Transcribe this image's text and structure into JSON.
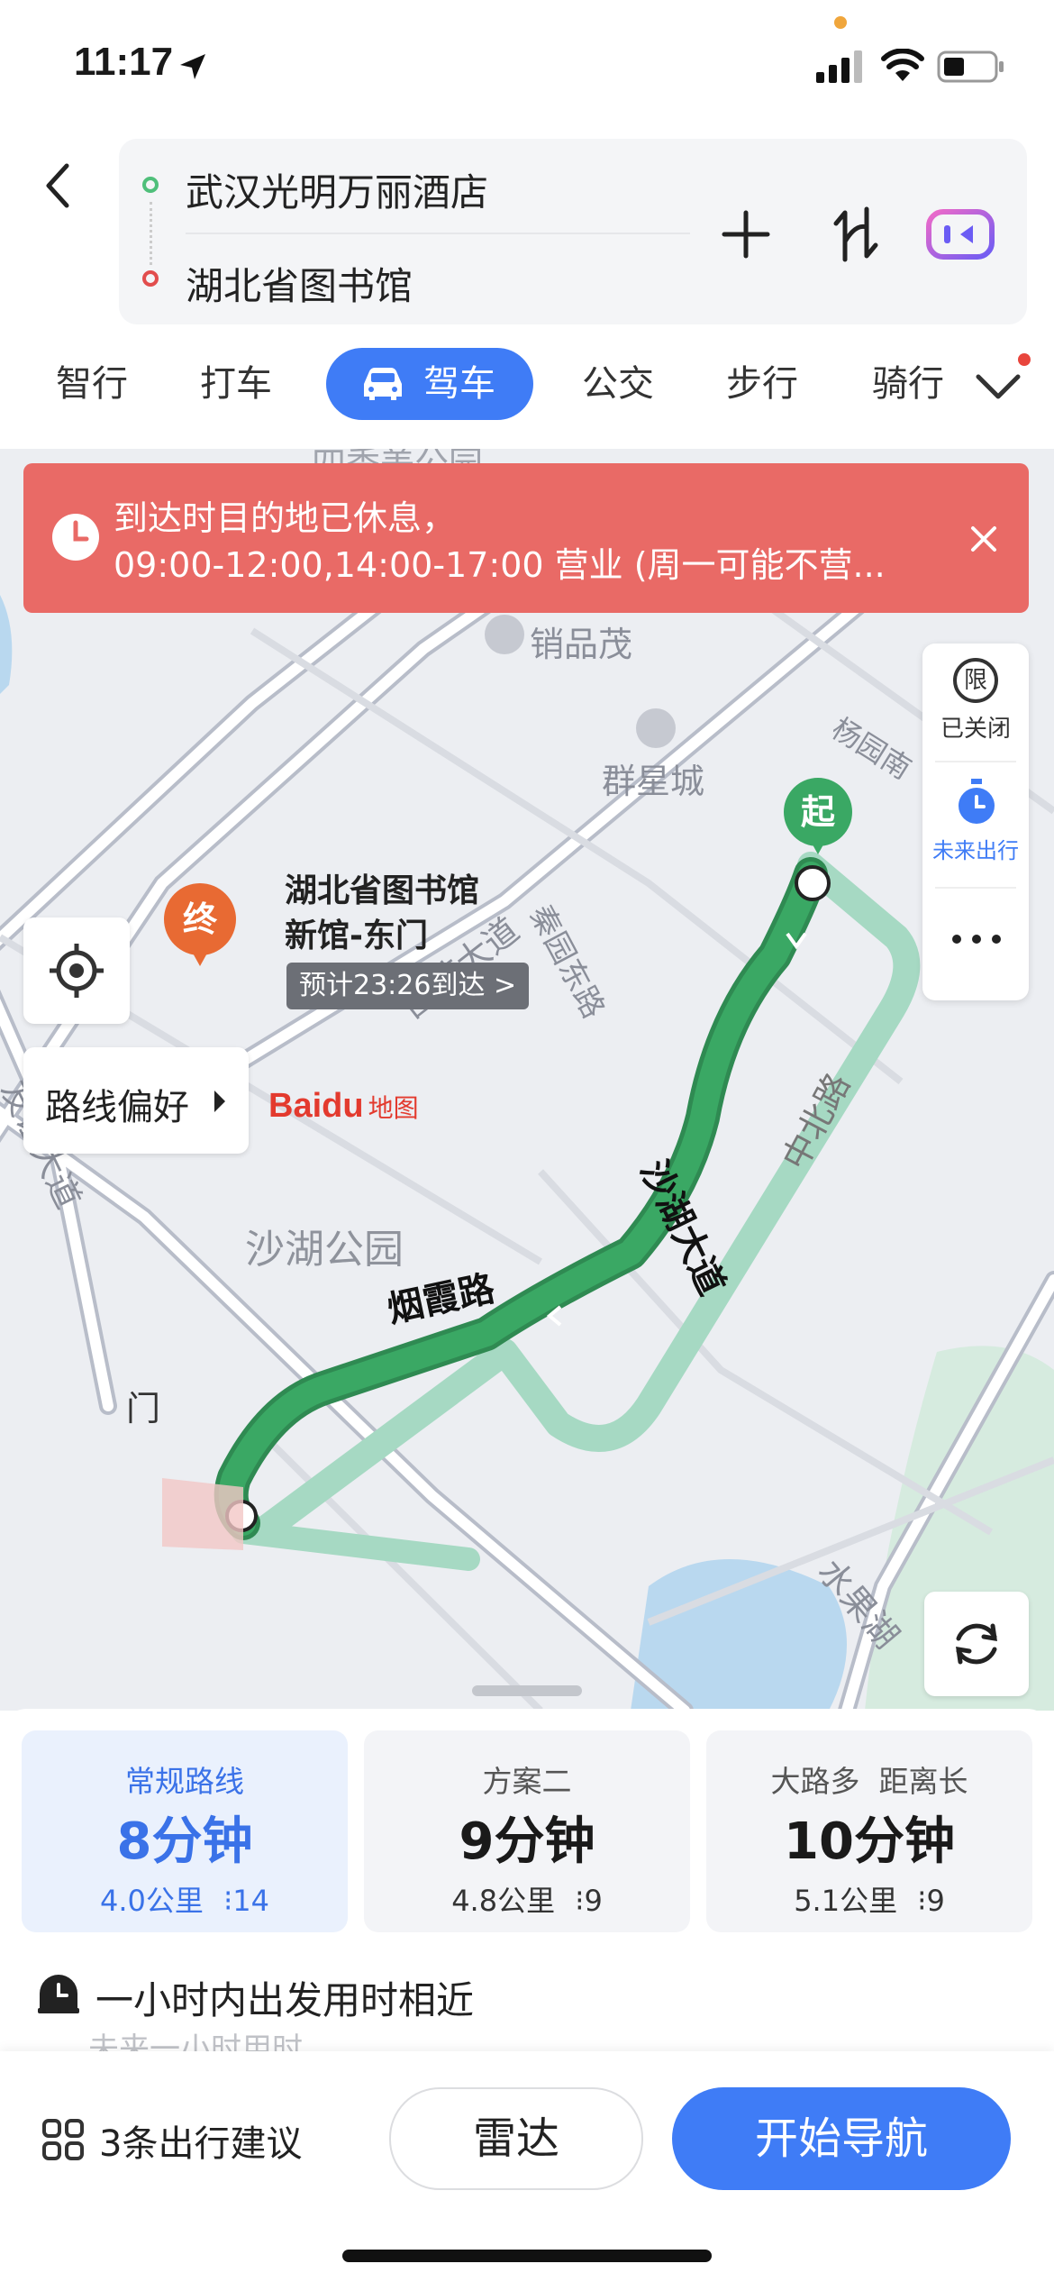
{
  "status_bar": {
    "time": "11:17"
  },
  "route": {
    "origin": "武汉光明万丽酒店",
    "destination": "湖北省图书馆"
  },
  "mode_tabs": [
    "智行",
    "打车",
    "驾车",
    "公交",
    "步行",
    "骑行"
  ],
  "alert": {
    "line1": "到达时目的地已休息，",
    "line2": "09:00-12:00,14:00-17:00 营业 (周一可能不营..."
  },
  "right_panel": {
    "restrict_label": "已关闭",
    "restrict_icon_char": "限",
    "future_label": "未来出行"
  },
  "map": {
    "labels": {
      "park_top": "四季美公园",
      "xiaopinmao": "销品茂",
      "qunxingcheng": "群星城",
      "yangyuan": "杨园南",
      "tuanjie": "团结大道",
      "qinyuan": "秦园东路",
      "youyi": "友谊大道",
      "shahu_park": "沙湖公园",
      "shahu_ave": "沙湖大道",
      "zhongbei": "中北路",
      "yanxia": "烟霞路",
      "shuiguohu": "水果湖",
      "men": "门"
    },
    "start_marker": "起",
    "end_marker": "终",
    "destination_label": "湖北省图书馆新馆-东门",
    "eta": "预计23:26到达 >",
    "route_pref": "路线偏好",
    "logo_baidu": "Baidu",
    "logo_map": "地图"
  },
  "routes": [
    {
      "label": "常规路线",
      "time": "8分钟",
      "distance": "4.0公里",
      "lights": "14"
    },
    {
      "label": "方案二",
      "time": "9分钟",
      "distance": "4.8公里",
      "lights": "9"
    },
    {
      "label": "大路多  距离长",
      "time": "10分钟",
      "distance": "5.1公里",
      "lights": "9"
    }
  ],
  "departure_hint": "一小时内出发用时相近",
  "departure_sub": "未来一小时用时",
  "action_bar": {
    "suggestions": "3条出行建议",
    "radar": "雷达",
    "start_nav": "开始导航"
  },
  "colors": {
    "accent": "#3f7cf6",
    "alert": "#e96a66",
    "route_main": "#3aa864",
    "route_alt": "#a6d9c3",
    "marker_start": "#3aa864",
    "marker_end": "#e86a33"
  }
}
